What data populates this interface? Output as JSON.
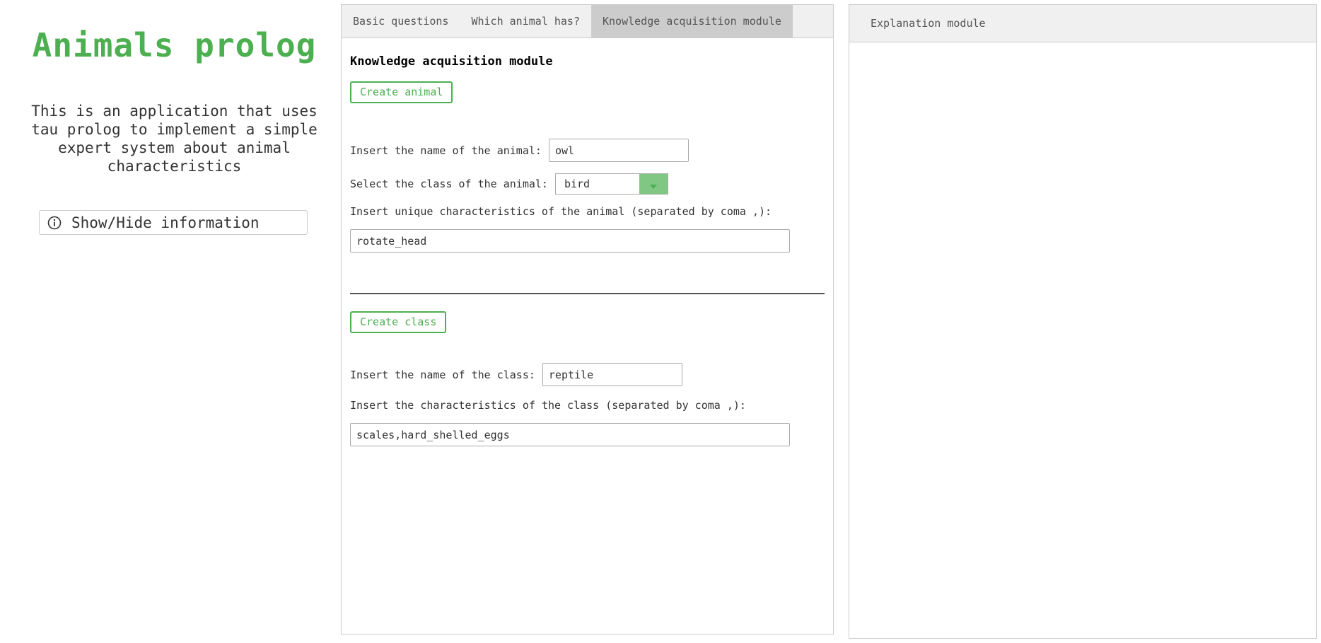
{
  "sidebar": {
    "title": "Animals prolog",
    "description": "This is an application that uses tau prolog to implement a simple expert system about animal characteristics",
    "info_button_label": "Show/Hide information",
    "info_icon": "info-circle-icon"
  },
  "colors": {
    "accent": "#4caf50",
    "accent_light": "#80c783",
    "tab_bar": "#f0f0f0",
    "tab_active": "#cccccc"
  },
  "tabs": [
    {
      "label": "Basic questions",
      "active": false
    },
    {
      "label": "Which animal has?",
      "active": false
    },
    {
      "label": "Knowledge acquisition module",
      "active": true
    }
  ],
  "knowledge": {
    "title": "Knowledge acquisition module",
    "animal": {
      "create_button": "Create animal",
      "name_label": "Insert the name of the animal:",
      "name_value": "owl",
      "class_label": "Select the class of the animal:",
      "class_value": "bird",
      "characteristics_label": "Insert unique characteristics of the animal (separated by coma ,):",
      "characteristics_value": "rotate_head"
    },
    "class": {
      "create_button": "Create class",
      "name_label": "Insert the name of the class:",
      "name_value": "reptile",
      "characteristics_label": "Insert the characteristics of the class (separated by coma ,):",
      "characteristics_value": "scales,hard_shelled_eggs"
    }
  },
  "explanation": {
    "header": "Explanation module"
  }
}
